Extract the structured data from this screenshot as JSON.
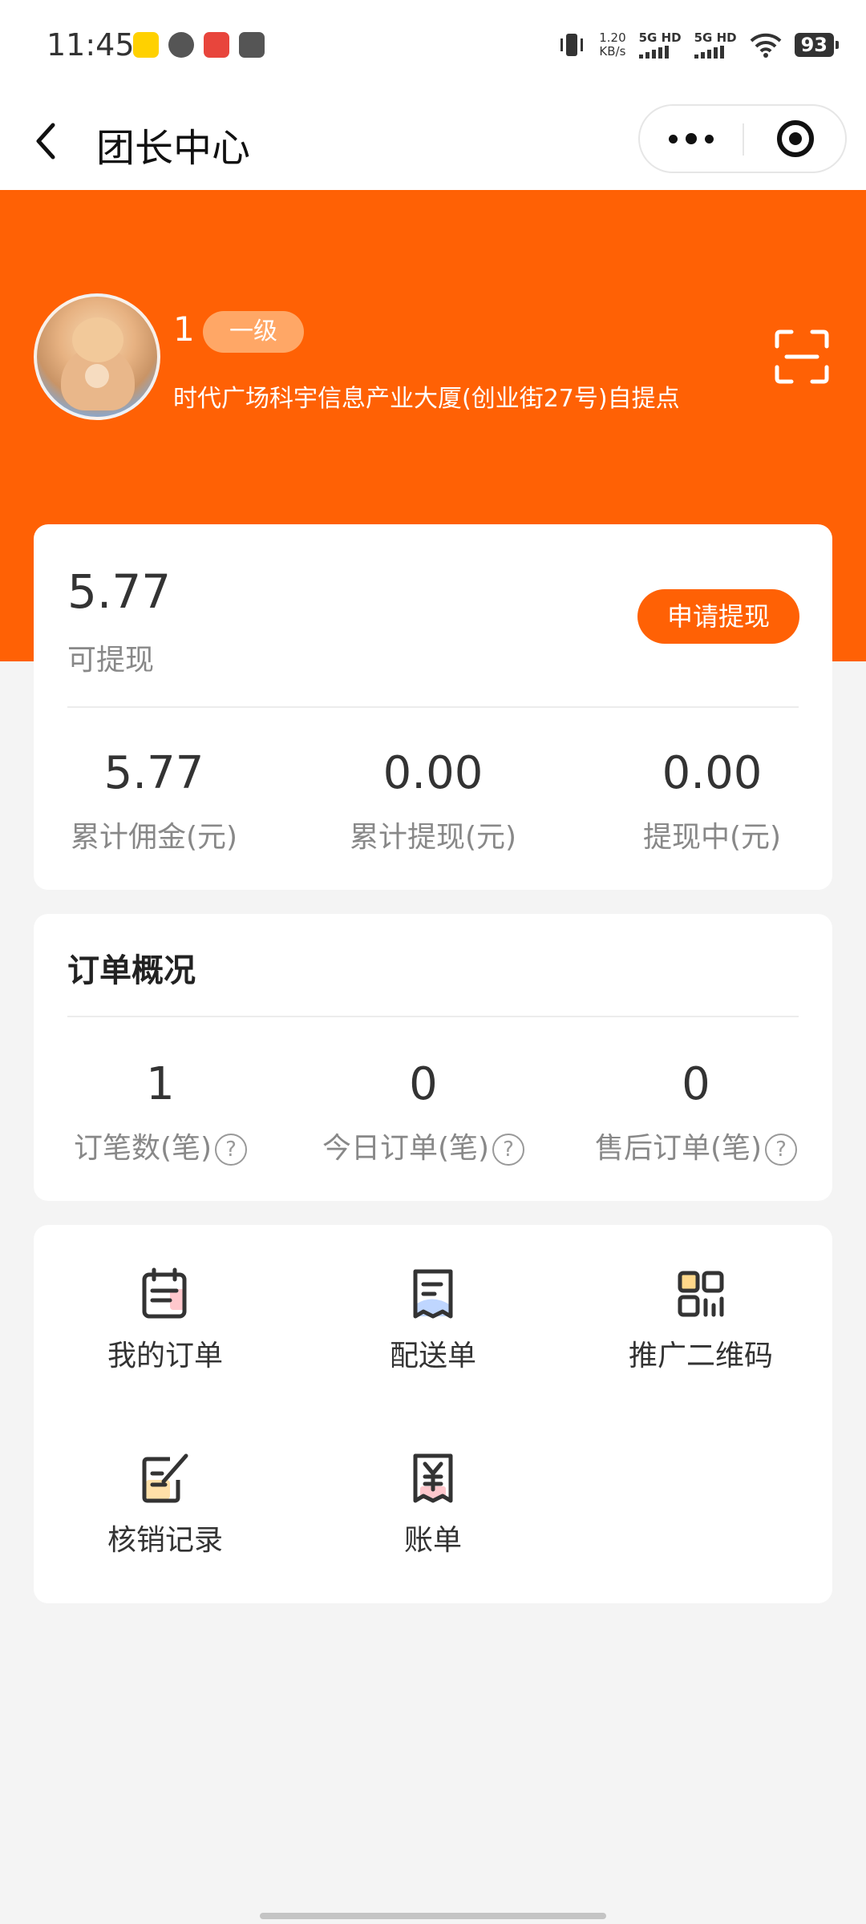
{
  "status_bar": {
    "time": "11:45",
    "net_speed_value": "1.20",
    "net_speed_unit": "KB/s",
    "sim1_label": "5G HD",
    "sim2_label": "5G HD",
    "battery": "93"
  },
  "nav": {
    "title": "团长中心"
  },
  "profile": {
    "name": "1",
    "level": "一级",
    "address": "时代广场科宇信息产业大厦(创业街27号)自提点"
  },
  "wallet": {
    "balance": "5.77",
    "balance_label": "可提现",
    "withdraw_button": "申请提现",
    "stats": [
      {
        "value": "5.77",
        "label": "累计佣金(元)"
      },
      {
        "value": "0.00",
        "label": "累计提现(元)"
      },
      {
        "value": "0.00",
        "label": "提现中(元)"
      }
    ]
  },
  "orders": {
    "title": "订单概况",
    "help_glyph": "?",
    "stats": [
      {
        "value": "1",
        "label": "订笔数(笔)"
      },
      {
        "value": "0",
        "label": "今日订单(笔)"
      },
      {
        "value": "0",
        "label": "售后订单(笔)"
      }
    ]
  },
  "menu": [
    {
      "label": "我的订单",
      "icon": "order-list-icon"
    },
    {
      "label": "配送单",
      "icon": "delivery-receipt-icon"
    },
    {
      "label": "推广二维码",
      "icon": "qr-code-icon"
    },
    {
      "label": "核销记录",
      "icon": "verify-record-icon"
    },
    {
      "label": "账单",
      "icon": "bill-yuan-icon"
    }
  ],
  "colors": {
    "brand_orange": "#ff6105",
    "badge_orange": "#ffa766",
    "page_bg": "#f4f4f4"
  }
}
